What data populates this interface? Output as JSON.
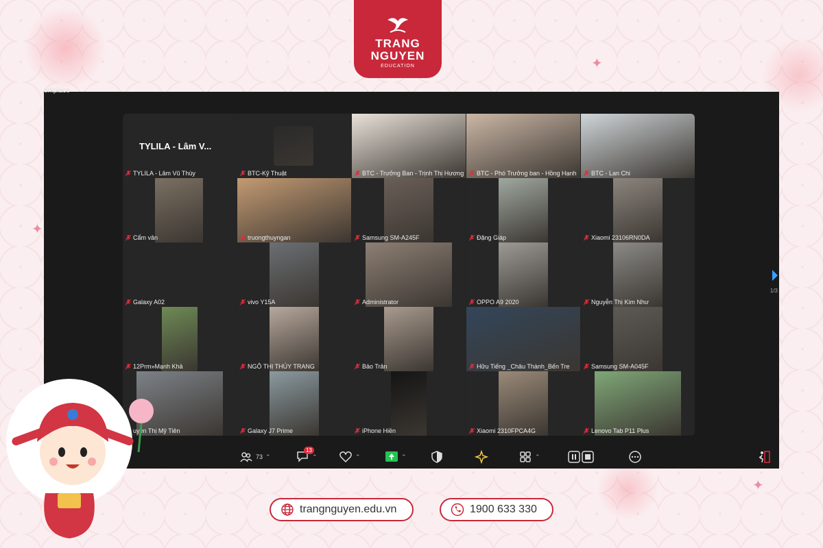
{
  "brand": {
    "line1": "TRANG",
    "line2": "NGUYEN",
    "line3": "EDUCATION"
  },
  "window": {
    "title": "orkplace"
  },
  "grid": {
    "featured_name": "TYLILA - Lâm V...",
    "participants": [
      {
        "name": "TYLILA - Lâm Vũ Thùy",
        "color": "#262626"
      },
      {
        "name": "BTC-Kỹ Thuật",
        "color": "#2a2a2a"
      },
      {
        "name": "BTC - Trưởng Ban - Trịnh Thị Hương",
        "color": "#e9e2da"
      },
      {
        "name": "BTC - Phó Trưởng ban - Hồng Hạnh",
        "color": "#cbb7a6"
      },
      {
        "name": "BTC - Lan Chi",
        "color": "#cfd5d8"
      },
      {
        "name": "Cẩm vân",
        "color": "#7a6f62"
      },
      {
        "name": "truongthuyngan",
        "color": "#c39a72"
      },
      {
        "name": "Samsung SM-A245F",
        "color": "#6a5f57"
      },
      {
        "name": "Đặng Giáp",
        "color": "#9fa8a0"
      },
      {
        "name": "Xiaomi 23106RN0DA",
        "color": "#8b857d"
      },
      {
        "name": "Galaxy A02",
        "color": "#262626"
      },
      {
        "name": "vivo Y15A",
        "color": "#6b6f73"
      },
      {
        "name": "Administrator",
        "color": "#8d7f74"
      },
      {
        "name": "OPPO A9 2020",
        "color": "#9d9a95"
      },
      {
        "name": "Nguyễn Thị Kim Như",
        "color": "#8a8a86"
      },
      {
        "name": "12Prm»Mạnh Khả",
        "color": "#6e8a55"
      },
      {
        "name": "NGÔ THỊ THÚY TRANG",
        "color": "#b7a89d"
      },
      {
        "name": "Bảo Trân",
        "color": "#a89a8e"
      },
      {
        "name": "Hữu Tiếng _Châu Thành_Bến Tre",
        "color": "#33465a"
      },
      {
        "name": "Samsung SM-A045F",
        "color": "#5d5a55"
      },
      {
        "name": "uyễn Thị Mỹ Tiên",
        "color": "#7d8288"
      },
      {
        "name": "Galaxy J7 Prime",
        "color": "#8a9aa0"
      },
      {
        "name": "iPhone Hiền",
        "color": "#151515"
      },
      {
        "name": "Xiaomi 2310FPCA4G",
        "color": "#9a8a78"
      },
      {
        "name": "Lenovo Tab P11 Plus",
        "color": "#7fa777"
      }
    ],
    "active_index": 3,
    "page_indicator": "1/3"
  },
  "toolbar": {
    "participants_count": "73",
    "chat_badge": "13"
  },
  "footer": {
    "website": "trangnguyen.edu.vn",
    "phone": "1900 633 330"
  },
  "colors": {
    "brand_red": "#c8283a",
    "active_green": "#33d067"
  }
}
